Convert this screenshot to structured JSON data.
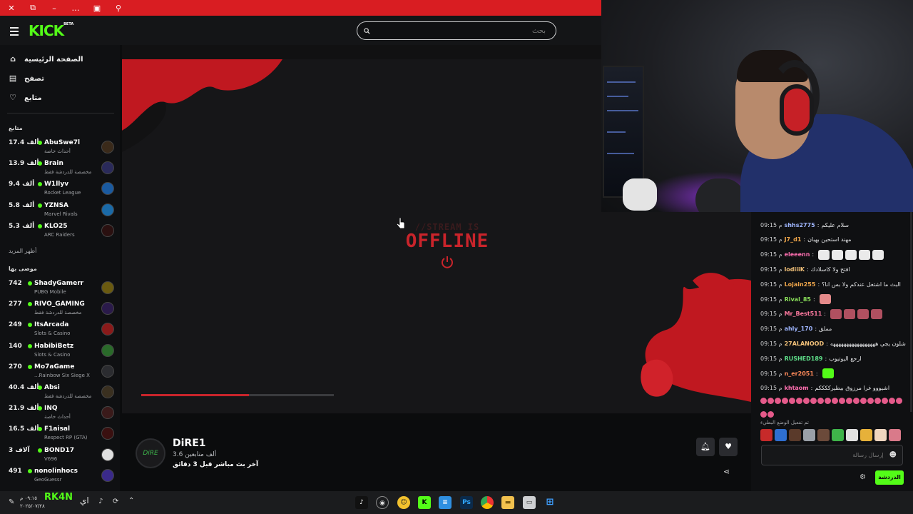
{
  "colors": {
    "brand": "#53fc18",
    "accent_red": "#c9242b",
    "browser_bar": "#d91d22"
  },
  "browser": {
    "icons": [
      "close-icon",
      "restore-icon",
      "minimize-icon",
      "more-icon",
      "reader-icon",
      "search-icon"
    ]
  },
  "header": {
    "logo": "KICK",
    "logo_badge": "BETA",
    "search_placeholder": "بحث"
  },
  "sidebar": {
    "nav": [
      {
        "label": "الصفحة الرئيسية",
        "icon": "home-icon"
      },
      {
        "label": "تصفح",
        "icon": "browse-icon"
      },
      {
        "label": "متابع",
        "icon": "heart-icon"
      }
    ],
    "following_title": "متابع",
    "following": [
      {
        "viewers": "17.4 ألف",
        "name": "AbuSwe7l",
        "category": "أحداث خاصة"
      },
      {
        "viewers": "13.9 ألف",
        "name": "Brain",
        "category": "مخصصة للدردشة فقط"
      },
      {
        "viewers": "9.4 ألف",
        "name": "W1llyv",
        "category": "Rocket League"
      },
      {
        "viewers": "5.8 ألف",
        "name": "YZNSA",
        "category": "Marvel Rivals"
      },
      {
        "viewers": "5.3 ألف",
        "name": "KLO25",
        "category": "ARC Raiders"
      }
    ],
    "show_more": "أظهر المزيد",
    "recommended_title": "موصى بها",
    "recommended": [
      {
        "viewers": "742",
        "name": "ShadyGamerr",
        "category": "PUBG Mobile"
      },
      {
        "viewers": "277",
        "name": "RIVO_GAMING",
        "category": "مخصصة للدردشة فقط"
      },
      {
        "viewers": "249",
        "name": "ItsArcada",
        "category": "Slots & Casino"
      },
      {
        "viewers": "140",
        "name": "HabibiBetz",
        "category": "Slots & Casino"
      },
      {
        "viewers": "270",
        "name": "Mo7aGame",
        "category": "...Rainbow Six Siege X"
      },
      {
        "viewers": "40.4 ألف",
        "name": "Absi",
        "category": "مخصصة للدردشة فقط"
      },
      {
        "viewers": "21.9 ألف",
        "name": "INQ",
        "category": "أحداث خاصة"
      },
      {
        "viewers": "16.5 ألف",
        "name": "F1aisal",
        "category": "Respect RP (GTA)"
      },
      {
        "viewers": "3 آلاف",
        "name": "BOND17",
        "category": "V696"
      },
      {
        "viewers": "491",
        "name": "nonolinhocs",
        "category": "GeoGuessr"
      }
    ]
  },
  "player": {
    "offline_small": "//STREAM IS",
    "offline_big": "OFFLINE",
    "progress": 0.56
  },
  "channel": {
    "avatar_text": "DiRE",
    "name": "DiRE1",
    "followers": "3.6 ألف متابعين",
    "last_live": "آخر بث مباشر قبل 3 دقائق"
  },
  "chat": {
    "messages": [
      {
        "time": "09:15 م",
        "user": "shhs2775",
        "color": "#9fb6ff",
        "text": "سلام عليكم"
      },
      {
        "time": "09:15 م",
        "user": "J7_d1",
        "color": "#f0a64a",
        "text": "مهند استحين بهبان"
      },
      {
        "time": "09:15 م",
        "user": "eleeenn",
        "color": "#ff6fb0",
        "text": ""
      },
      {
        "time": "09:15 م",
        "user": "lodiiiK",
        "color": "#f3c27a",
        "text": "افتح ولا كاسلادك"
      },
      {
        "time": "09:15 م",
        "user": "Lojain255",
        "color": "#f0a64a",
        "text": "البث ما اشتغل عندكم ولا بس انا؟"
      },
      {
        "time": "09:15 م",
        "user": "Rival_85",
        "color": "#8ae05a",
        "text": ""
      },
      {
        "time": "09:15 م",
        "user": "Mr_Best511",
        "color": "#ff7aa0",
        "text": ""
      },
      {
        "time": "09:15 م",
        "user": "ahly_170",
        "color": "#9fb6ff",
        "text": "مملق"
      },
      {
        "time": "09:15 م",
        "user": "27ALANOOD",
        "color": "#f3c27a",
        "text": "شلون يجي هههههههههههههههههه"
      },
      {
        "time": "09:15 م",
        "user": "RUSHED189",
        "color": "#5fe08a",
        "text": "ارجع اليوتيوب"
      },
      {
        "time": "09:15 م",
        "user": "n_er2051",
        "color": "#ff8a5a",
        "text": ""
      },
      {
        "time": "09:15 م",
        "user": "khtaom",
        "color": "#ff6fb0",
        "text": "اشيووو غرا مرزوق بيطيرككككم"
      }
    ],
    "emote_note": "تم تفعيل الوضع البطيء",
    "input_placeholder": "إرسال رسالة",
    "send_label": "الدردشة"
  },
  "taskbar": {
    "clock_time": "٠٩:١٥ م",
    "clock_date": "٢٠٢٥/٠٧/٢٨",
    "lang": "اي",
    "user_tag": "RK4N",
    "apps": [
      "tiktok-icon",
      "steam-icon",
      "discord-icon",
      "kick-icon",
      "notepad-icon",
      "photoshop-icon",
      "chrome-icon",
      "explorer-icon",
      "desktop-icon",
      "start-icon"
    ]
  }
}
